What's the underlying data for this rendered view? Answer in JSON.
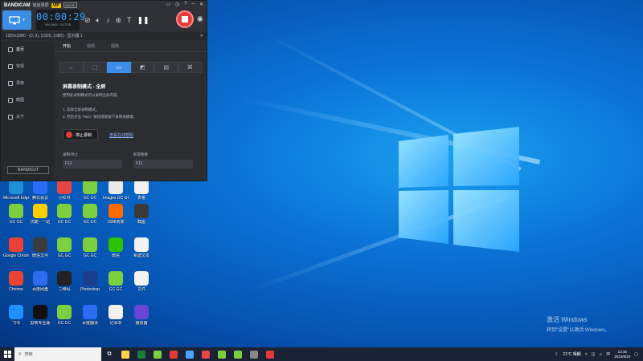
{
  "bandicam": {
    "brand": "BANDICAM",
    "brand_sub": "班迪录屏",
    "vip": "VIP",
    "admin": "ADMIN",
    "timer": "00:00:29",
    "file_size": "959.3KB / 24.7GB",
    "info_bar": "1920x1080 - (0, 0), (1920, 1080) - 显示器 1",
    "sidebar": [
      {
        "label": "首页",
        "active": true
      },
      {
        "label": "常规",
        "active": false
      },
      {
        "label": "录像",
        "active": false
      },
      {
        "label": "截图",
        "active": false
      },
      {
        "label": "关于",
        "active": false
      }
    ],
    "bandicut": "BANDICUT",
    "tabs": [
      {
        "label": "开始",
        "active": true
      },
      {
        "label": "视频",
        "active": false
      },
      {
        "label": "图像",
        "active": false
      }
    ],
    "mode_title": "屏幕录制模式 - 全屏",
    "mode_desc": "使用此录制模式可以录制全屏内容。",
    "steps": [
      "1. 选择全屏录制模式。",
      "2. 然后点击 \"REC\" 按钮或者按下录制快捷键。"
    ],
    "stop_button": "停止录制",
    "help_link": "查看在线帮助",
    "hotkey_record_label": "录制/停止",
    "hotkey_record_value": "F12",
    "hotkey_capture_label": "抓取图像",
    "hotkey_capture_value": "F11"
  },
  "desktop_icons": [
    {
      "label": "Microsoft Edge",
      "color": "#1f8fd8"
    },
    {
      "label": "腾讯会议",
      "color": "#2a6cf5"
    },
    {
      "label": "小红书",
      "color": "#e84545"
    },
    {
      "label": "GC GC",
      "color": "#7ccf3f"
    },
    {
      "label": "Images GC GC",
      "color": "#e9e9e9"
    },
    {
      "label": "表格",
      "color": "#f2f2f2"
    },
    {
      "label": "GC GC",
      "color": "#7ccf3f"
    },
    {
      "label": "优酷 - 一站",
      "color": "#ffcf00"
    },
    {
      "label": "GC GC",
      "color": "#7ccf3f"
    },
    {
      "label": "GC GC",
      "color": "#7ccf3f"
    },
    {
      "label": "1688商家",
      "color": "#ff6a00"
    },
    {
      "label": "截图",
      "color": "#3a3a3a"
    },
    {
      "label": "Google Chrome",
      "color": "#ea4335"
    },
    {
      "label": "微信文件",
      "color": "#3b3b3b"
    },
    {
      "label": "GC GC",
      "color": "#7ccf3f"
    },
    {
      "label": "GC GC",
      "color": "#7ccf3f"
    },
    {
      "label": "微信",
      "color": "#2dc100"
    },
    {
      "label": "新建文本",
      "color": "#f2f2f2"
    },
    {
      "label": "Chrome",
      "color": "#ea4335"
    },
    {
      "label": "百度网盘",
      "color": "#2c6cf2"
    },
    {
      "label": "二维码",
      "color": "#222"
    },
    {
      "label": "Photoshop",
      "color": "#1c3f8b"
    },
    {
      "label": "GC GC",
      "color": "#7ccf3f"
    },
    {
      "label": "文件",
      "color": "#f2f2f2"
    },
    {
      "label": "飞书",
      "color": "#1e90ff"
    },
    {
      "label": "剪映专业版",
      "color": "#111"
    },
    {
      "label": "GC GC",
      "color": "#7ccf3f"
    },
    {
      "label": "百度翻译",
      "color": "#2c6cf2"
    },
    {
      "label": "记事本",
      "color": "#f2f2f2"
    },
    {
      "label": "播放器",
      "color": "#6a45d8"
    }
  ],
  "activation": {
    "title": "激活 Windows",
    "subtitle": "转到\"设置\"以激活 Windows。"
  },
  "taskbar": {
    "search_placeholder": "搜索",
    "weather": "21°C 晴朗",
    "time": "13:15",
    "date": "2023/9/20",
    "apps": [
      "#ffd24a",
      "#1b7a3c",
      "#7ccf3f",
      "#e33a3a",
      "#4aa3ff",
      "#e84545",
      "#7ccf3f",
      "#7ccf3f",
      "#888888",
      "#e33a3a"
    ]
  }
}
